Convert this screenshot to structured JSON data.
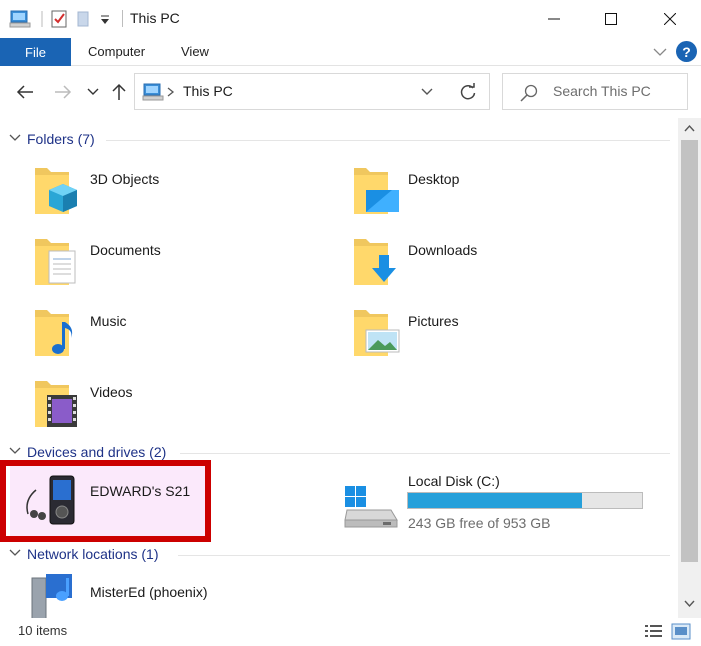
{
  "window": {
    "title": "This PC",
    "minimize_glyph": "—",
    "maximize_glyph": "☐",
    "close_glyph": "✕"
  },
  "ribbon": {
    "tabs": [
      "File",
      "Computer",
      "View"
    ],
    "help_glyph": "?",
    "accent": "#1a64b4"
  },
  "nav": {
    "breadcrumb": "This PC",
    "search_placeholder": "Search This PC"
  },
  "groups": {
    "folders": {
      "title": "Folders (7)",
      "items": [
        {
          "label": "3D Objects",
          "icon": "3d-objects-folder-icon"
        },
        {
          "label": "Desktop",
          "icon": "desktop-folder-icon"
        },
        {
          "label": "Documents",
          "icon": "documents-folder-icon"
        },
        {
          "label": "Downloads",
          "icon": "downloads-folder-icon"
        },
        {
          "label": "Music",
          "icon": "music-folder-icon"
        },
        {
          "label": "Pictures",
          "icon": "pictures-folder-icon"
        },
        {
          "label": "Videos",
          "icon": "videos-folder-icon"
        }
      ]
    },
    "devices": {
      "title": "Devices and drives (2)",
      "items": [
        {
          "label": "EDWARD's S21",
          "icon": "media-player-icon",
          "highlighted": true
        },
        {
          "label": "Local Disk (C:)",
          "icon": "local-disk-icon",
          "free_text": "243 GB free of 953 GB",
          "used_fraction": 0.745
        }
      ]
    },
    "network": {
      "title": "Network locations (1)",
      "items": [
        {
          "label": "MisterEd (phoenix)",
          "icon": "media-server-icon"
        }
      ]
    }
  },
  "status": {
    "item_count": "10 items"
  },
  "colors": {
    "highlight_border": "#cc0000",
    "progress_fill": "#26a0da",
    "group_title": "#1e3287"
  }
}
